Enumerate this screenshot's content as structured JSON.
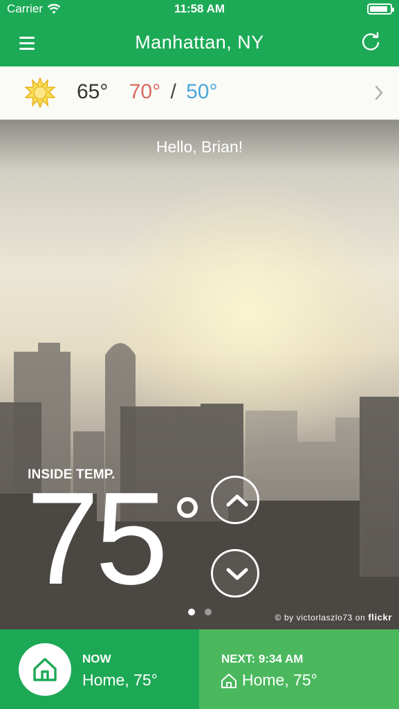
{
  "status_bar": {
    "carrier": "Carrier",
    "time": "11:58 AM",
    "battery_level": 0.9
  },
  "header": {
    "location": "Manhattan, NY"
  },
  "weather": {
    "icon": "sun-icon",
    "current": "65°",
    "high": "70°",
    "separator": "/",
    "low": "50°"
  },
  "hero": {
    "greeting": "Hello, Brian!",
    "inside_label": "INSIDE TEMP.",
    "temperature": "75",
    "page_count": 2,
    "active_page": 1,
    "credit_prefix": "© by victorlaszlo73 on ",
    "credit_brand": "flickr"
  },
  "bottom": {
    "now": {
      "label": "NOW",
      "value": "Home, 75°"
    },
    "next": {
      "label": "NEXT: 9:34 AM",
      "value": "Home, 75°"
    }
  },
  "colors": {
    "brand_green": "#1daa57",
    "next_green": "#4bb85e",
    "high": "#d9695f",
    "low": "#4aa8dc",
    "sun": "#f6d23a"
  }
}
